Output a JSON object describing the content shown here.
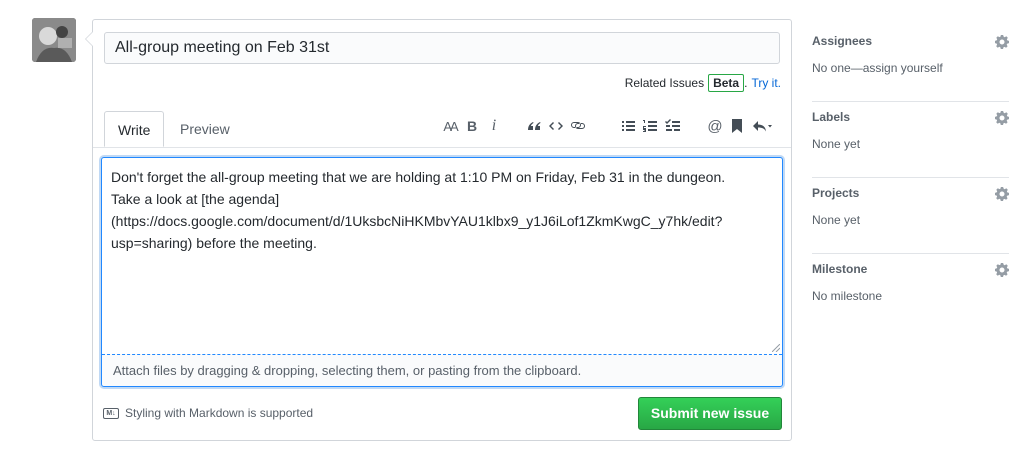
{
  "issue": {
    "title_value": "All-group meeting on Feb 31st",
    "related_label": "Related Issues",
    "beta_badge": "Beta",
    "try_it_link": "Try it.",
    "tabs": [
      {
        "label": "Write"
      },
      {
        "label": "Preview"
      }
    ],
    "toolbar": {
      "heading_glyph": "AA",
      "bold_glyph": "B",
      "italic_glyph": "i",
      "quote_glyph": "“",
      "code_glyph": "<>"
    },
    "body_text": "Don't forget the all-group meeting that we are holding at 1:10 PM on Friday, Feb 31 in the dungeon.\nTake a look at [the agenda]\n(https://docs.google.com/document/d/1UksbcNiHKMbvYAU1klbx9_y1J6iLof1ZkmKwgC_y7hk/edit?\nusp=sharing) before the meeting.",
    "attach_hint": "Attach files by dragging & dropping, selecting them, or pasting from the clipboard.",
    "markdown_note": "Styling with Markdown is supported",
    "markdown_icon": "M↓",
    "submit_label": "Submit new issue"
  },
  "sidebar": {
    "sections": [
      {
        "title": "Assignees",
        "value": "No one—assign yourself"
      },
      {
        "title": "Labels",
        "value": "None yet"
      },
      {
        "title": "Projects",
        "value": "None yet"
      },
      {
        "title": "Milestone",
        "value": "No milestone"
      }
    ]
  },
  "colors": {
    "accent": "#0366d6",
    "submit_green": "#28a745",
    "focus_blue": "#2188ff"
  },
  "icons": [
    "avatar",
    "heading-icon",
    "bold-icon",
    "italic-icon",
    "quote-icon",
    "code-icon",
    "link-icon",
    "bullet-list-icon",
    "numbered-list-icon",
    "task-list-icon",
    "mention-icon",
    "bookmark-icon",
    "reply-icon",
    "markdown-icon",
    "gear-icon"
  ]
}
